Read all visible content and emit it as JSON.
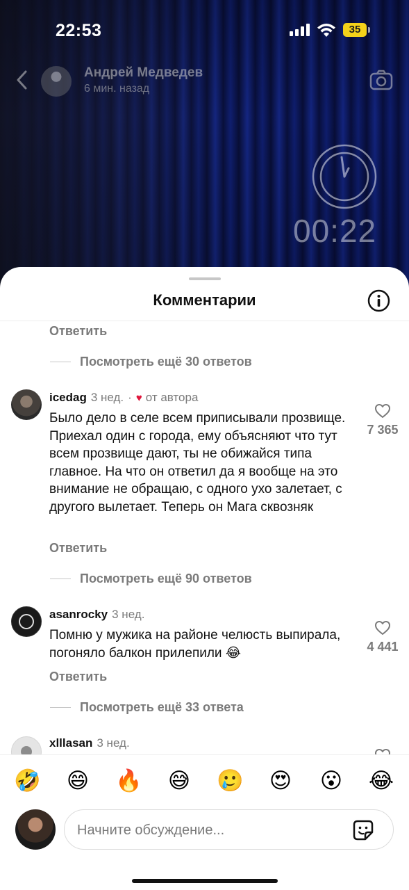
{
  "status": {
    "time": "22:53",
    "battery": "35"
  },
  "header": {
    "name": "Андрей Медведев",
    "subtitle": "6 мин. назад"
  },
  "video": {
    "timer": "00:22"
  },
  "sheet": {
    "title": "Комментарии"
  },
  "thread_top": {
    "reply": "Ответить",
    "more": "Посмотреть ещё 30 ответов"
  },
  "comments": [
    {
      "user": "icedag",
      "ago": "3 нед.",
      "author_badge": "от автора",
      "text": "Было дело в селе всем приписывали прозвище. Приехал один с города, ему объясняют что тут всем прозвище дают, ты не обижайся типа главное. На что он ответил да я вообще на это внимание не обращаю, с одного ухо залетает, с другого вылетает. Теперь он Мага сквозняк",
      "likes": "7 365",
      "reply": "Ответить",
      "more": "Посмотреть ещё 90 ответов"
    },
    {
      "user": "asanrocky",
      "ago": "3 нед.",
      "text": "Помню у мужика на районе челюсть выпирала, погоняло балкон прилепили 😂",
      "likes": "4 441",
      "reply": "Ответить",
      "more": "Посмотреть ещё 33 ответа"
    },
    {
      "user": "xlllasan",
      "ago": "3 нед."
    }
  ],
  "emojis": [
    "🤣",
    "😄",
    "🔥",
    "😅",
    "🥲",
    "😍",
    "😮",
    "😂"
  ],
  "composer": {
    "placeholder": "Начните обсуждение..."
  },
  "colors": {
    "accent_heart": "#e0163c",
    "battery": "#f4d21a"
  },
  "icons": [
    "back-icon",
    "camera-icon",
    "info-icon",
    "heart-icon",
    "sticker-icon"
  ]
}
